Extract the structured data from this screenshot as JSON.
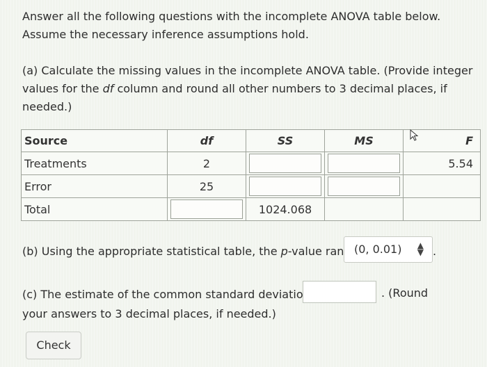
{
  "intro": {
    "line1": "Answer all the following questions with the incomplete ANOVA table below.",
    "line2": "Assume the necessary inference assumptions hold."
  },
  "part_a": {
    "line1": "(a) Calculate the missing values in the incomplete ANOVA table. (Provide integer",
    "line2_pre": "values for the ",
    "line2_em": "df",
    "line2_post": " column and round all other numbers to 3 decimal places, if",
    "line3": "needed.)"
  },
  "table": {
    "headers": {
      "source": "Source",
      "df": "df",
      "ss": "SS",
      "ms": "MS",
      "f": "F"
    },
    "rows": [
      {
        "source": "Treatments",
        "df": "2",
        "ss": "",
        "ms": "",
        "f": "5.54"
      },
      {
        "source": "Error",
        "df": "25",
        "ss": "",
        "ms": "",
        "f": ""
      },
      {
        "source": "Total",
        "df": "",
        "ss": "1024.068",
        "ms": "",
        "f": ""
      }
    ]
  },
  "part_b": {
    "pre": "(b) Using the appropriate statistical table, the ",
    "em": "p",
    "post": "-value range is",
    "selected": "(0, 0.01)",
    "trail": "."
  },
  "part_c": {
    "line1_pre": "(c) The estimate of the common standard deviation is",
    "line1_post": ". (Round",
    "line2": "your answers to 3 decimal places, if needed.)",
    "input_value": ""
  },
  "check_label": "Check"
}
